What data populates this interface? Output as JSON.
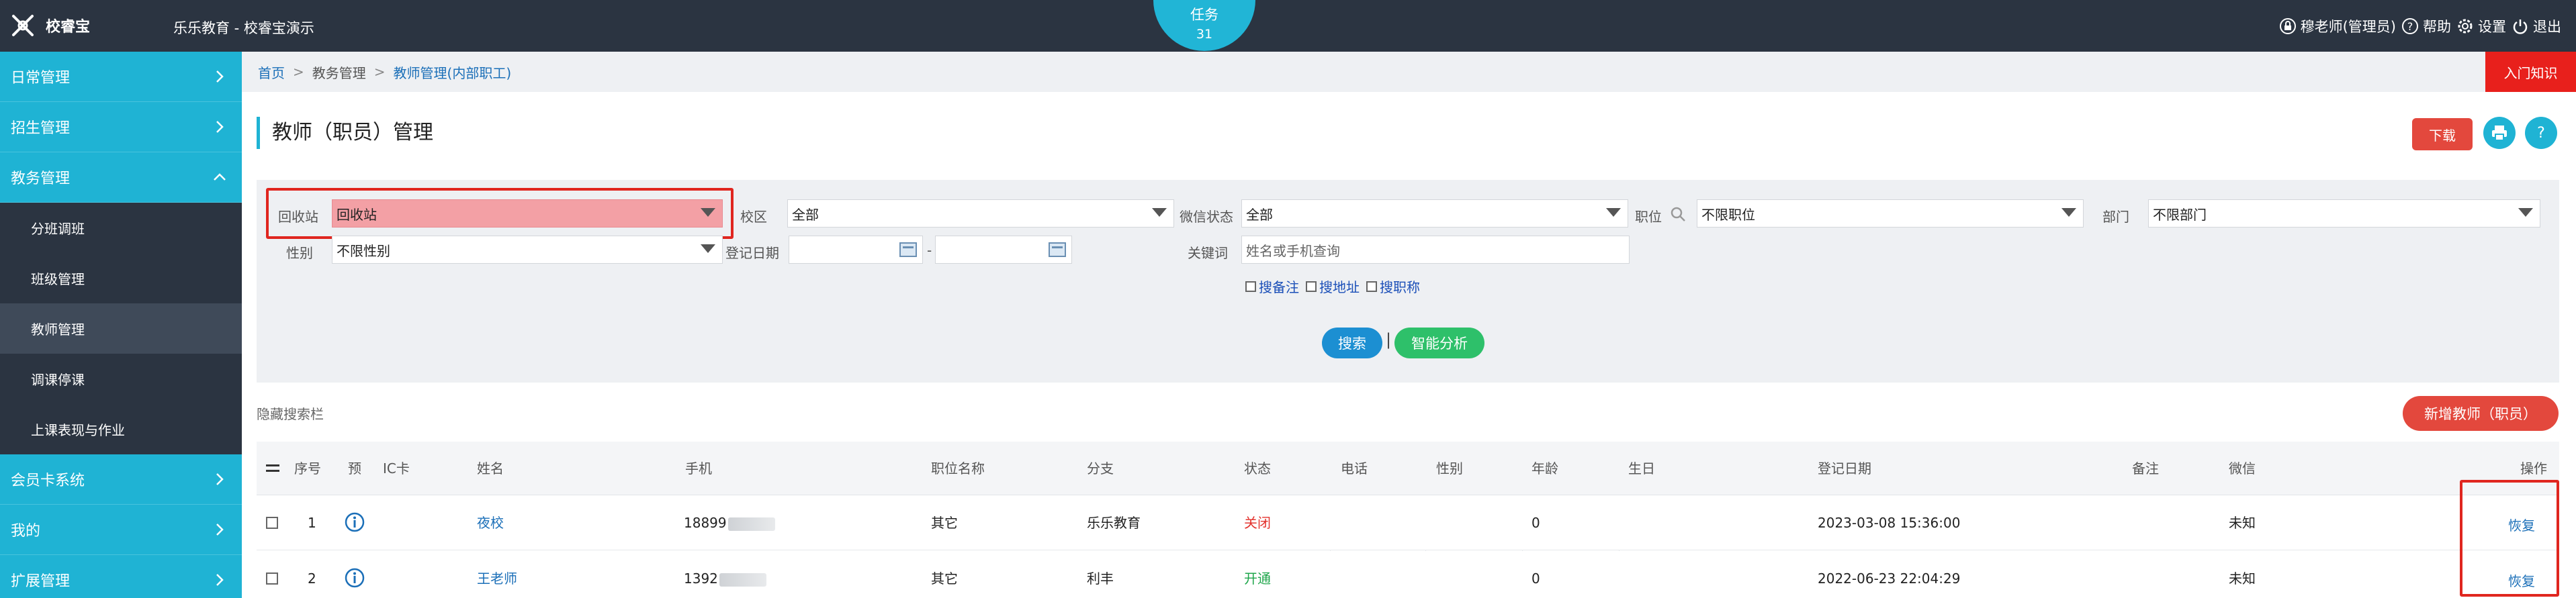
{
  "topbar": {
    "logo_text": "校睿宝",
    "app_title": "乐乐教育 - 校睿宝演示",
    "task_label": "任务",
    "task_count": "31",
    "user": "穆老师(管理员)",
    "help": "帮助",
    "settings": "设置",
    "logout": "退出"
  },
  "sidebar": {
    "items": [
      {
        "label": "日常管理",
        "expanded": false
      },
      {
        "label": "招生管理",
        "expanded": false
      },
      {
        "label": "教务管理",
        "expanded": true
      },
      {
        "label": "会员卡系统",
        "expanded": false
      },
      {
        "label": "我的",
        "expanded": false
      },
      {
        "label": "扩展管理",
        "expanded": false
      }
    ],
    "sub_items": [
      {
        "label": "分班调班"
      },
      {
        "label": "班级管理"
      },
      {
        "label": "教师管理",
        "active": true
      },
      {
        "label": "调课停课"
      },
      {
        "label": "上课表现与作业"
      }
    ]
  },
  "breadcrumb": {
    "home": "首页",
    "level1": "教务管理",
    "level2": "教师管理(内部职工)"
  },
  "intro_button": "入门知识",
  "page_title": "教师（职员）管理",
  "download_button": "下载",
  "help_button": "?",
  "filters": {
    "recycle_label": "回收站",
    "recycle_value": "回收站",
    "campus_label": "校区",
    "campus_value": "全部",
    "wechat_status_label": "微信状态",
    "wechat_status_value": "全部",
    "position_label": "职位",
    "position_value": "不限职位",
    "department_label": "部门",
    "department_value": "不限部门",
    "gender_label": "性别",
    "gender_value": "不限性别",
    "reg_date_label": "登记日期",
    "date_sep": "-",
    "keyword_label": "关键词",
    "keyword_placeholder": "姓名或手机查询",
    "checkbox_notes": "搜备注",
    "checkbox_address": "搜地址",
    "checkbox_title": "搜职称",
    "search_button": "搜索",
    "divider": "|",
    "smart_button": "智能分析"
  },
  "hide_search": "隐藏搜索栏",
  "add_button": "新增教师（职员）",
  "table": {
    "headers": {
      "seq": "序号",
      "pre": "预",
      "ic": "IC卡",
      "name": "姓名",
      "phone": "手机",
      "title": "职位名称",
      "branch": "分支",
      "status": "状态",
      "tel": "电话",
      "gender": "性别",
      "age": "年龄",
      "birthday": "生日",
      "reg_date": "登记日期",
      "notes": "备注",
      "wechat": "微信",
      "action": "操作"
    },
    "rows": [
      {
        "seq": "1",
        "name": "夜校",
        "phone": "18899",
        "title": "其它",
        "branch": "乐乐教育",
        "status": "关闭",
        "age": "0",
        "reg_date": "2023-03-08 15:36:00",
        "wechat": "未知",
        "action": "恢复"
      },
      {
        "seq": "2",
        "name": "王老师",
        "phone": "1392",
        "title": "其它",
        "branch": "利丰",
        "status": "开通",
        "age": "0",
        "reg_date": "2022-06-23 22:04:29",
        "wechat": "未知",
        "action": "恢复"
      }
    ]
  },
  "colors": {
    "topbar": "#2b3441",
    "accent": "#1fb3d4",
    "danger": "#e3483d",
    "highlight": "#e0261f"
  }
}
